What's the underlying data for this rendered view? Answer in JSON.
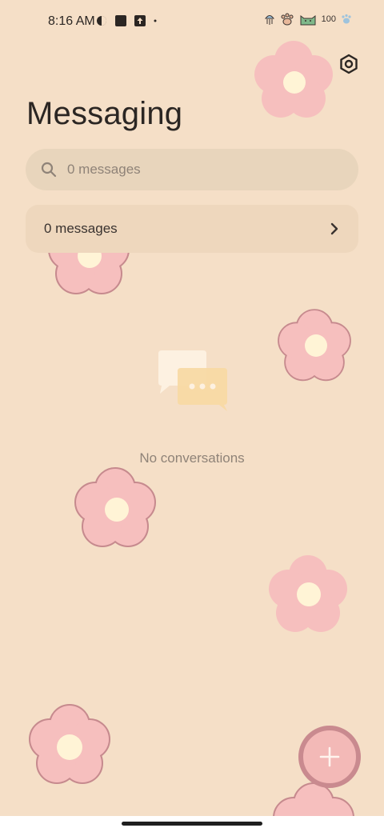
{
  "status_bar": {
    "time": "8:16 AM",
    "battery": "100"
  },
  "header": {
    "title": "Messaging"
  },
  "search": {
    "placeholder": "0 messages"
  },
  "messages_row": {
    "label": "0 messages"
  },
  "empty_state": {
    "text": "No conversations"
  },
  "icons": {
    "settings": "settings-icon",
    "search": "search-icon",
    "chevron": "chevron-right-icon",
    "fab": "plus-icon"
  },
  "colors": {
    "background": "#f5dfc7",
    "search_bg": "#e8d5bc",
    "flower_pink": "#f6bfbe",
    "flower_outline": "#c68a8e",
    "flower_center": "#fff4d6",
    "fab_border": "#c98a8f"
  }
}
